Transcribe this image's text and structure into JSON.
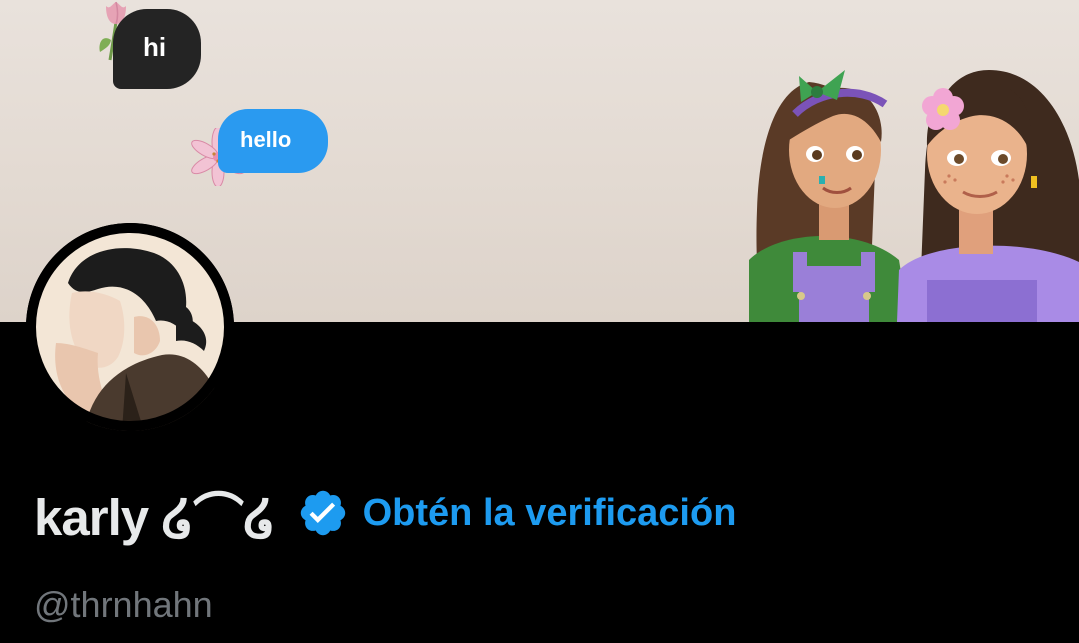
{
  "banner": {
    "bubble_hi": "hi",
    "bubble_hello": "hello"
  },
  "profile": {
    "display_name": "karly ໒⌒໒",
    "get_verified_label": "Obtén la verificación",
    "handle": "@thrnhahn"
  },
  "colors": {
    "background": "#000000",
    "accent_blue": "#1d9bf0",
    "name_text": "#e7e9ea",
    "handle_text": "#71767b"
  },
  "icons": [
    "tulip-icon",
    "lily-flower-icon",
    "verified-badge-icon"
  ]
}
